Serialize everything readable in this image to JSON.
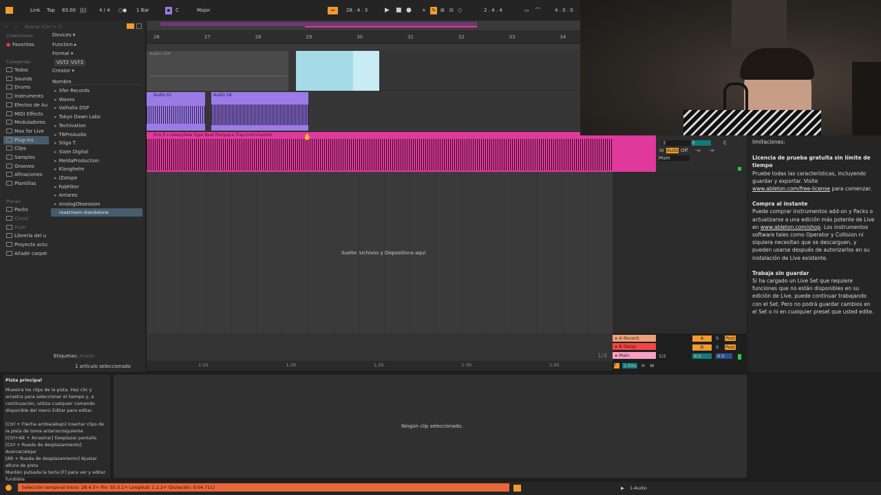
{
  "transport": {
    "link": "Link",
    "tap": "Tap",
    "tempo": "83.00",
    "meter_bars": "||||",
    "time_signature": "4 / 4",
    "metronome": "○●",
    "quantize": "1 Bar",
    "key_root": "C",
    "scale": "Major",
    "position": "28 .  4 .  3",
    "loop_start": "2 .  4 .  4",
    "loop_length": "4 .  0 .  0"
  },
  "browser": {
    "search_placeholder": "Buscar (Ctrl + F)",
    "collections_header": "Colecciones",
    "favorites": "Favoritos",
    "categories_header": "Categorías",
    "categories": [
      "Todos",
      "Sounds",
      "Drums",
      "Instruments",
      "Efectos de Au",
      "MIDI Effects",
      "Moduladores",
      "Max for Live",
      "Plug-ins",
      "Clips",
      "Samples",
      "Grooves",
      "Afinaciones",
      "Plantillas"
    ],
    "places_header": "Places",
    "places": [
      "Packs",
      "Cloud",
      "Push",
      "Librería del u",
      "Proyecto actu",
      "Añadir carpet"
    ],
    "filters": [
      "Devices ▾",
      "Function ▸",
      "Format ▾",
      "Creator ▾"
    ],
    "vst2": "VST2",
    "vst3": "VST3",
    "name_header": "Nombre",
    "items": [
      "Xfer Records",
      "Waves",
      "Valhalla DSP",
      "Tokyo Dawn Labs",
      "Techivation",
      "TBProAudio",
      "Stiga T.",
      "Slate Digital",
      "MeldaProduction",
      "Klanghelm",
      "iZotope",
      "FabFilter",
      "Antares",
      "AnalogObsession"
    ],
    "selected_item": "reastream-standalone",
    "tags_label": "Etiquetas:",
    "tags_value": "Añadir",
    "selection_count": "1 artículo seleccionado"
  },
  "ruler": {
    "bars": [
      "26",
      "27",
      "28",
      "29",
      "30",
      "31",
      "32",
      "33",
      "34"
    ]
  },
  "timeline": {
    "times": [
      "1:15",
      "1:20",
      "1:25",
      "1:30",
      "1:35"
    ],
    "grid": "1/4"
  },
  "tracks": {
    "track1_clip": "Audio 104",
    "track2_clip_a": "Audio 61",
    "track2_clip_b": "Audio 58",
    "track3_clip": "Kris R x GeezyDew Type Beat  Pampaca  Trap Instrumental",
    "drop_text": "Suelte Archivos y Dispositivos aquí"
  },
  "mixer": {
    "input_value": "2",
    "in": "In",
    "auto": "Auto",
    "off": "Off",
    "out_main": "Main",
    "vol_0": "0",
    "pan_c": "C",
    "minus_inf_1": "-∞",
    "minus_inf_2": "-∞"
  },
  "returns": {
    "reverb": "A Reverb",
    "delay": "B Delay",
    "main": "Main",
    "a": "A",
    "b": "B",
    "s": "S",
    "post": "Post",
    "half": "1/2",
    "minus_6_a": "-6.0",
    "minus_6_b": "-6.0",
    "speed": "1.00x",
    "h": "H",
    "w": "W"
  },
  "info_panel": {
    "p0": "limitaciones:",
    "h1": "Licencia de prueba gratuita sin límite de tiempo",
    "p1a": "Pruebe todas las características, incluyendo guardar y exportar. Visite ",
    "p1link": "www.ableton.com/free-license",
    "p1b": " para comenzar.",
    "h2": "Compra al instante",
    "p2a": "Puede comprar instrumentos add-on y Packs o actualizarse a una edición más potente de Live en ",
    "p2link": "www.ableton.com/shop",
    "p2b": ". Los instrumentos software tales como Operator y Collision ni siquiera necesitan que se descarguen, y pueden usarse después de autorizarlos en su instalación de Live existente.",
    "h3": "Trabaja sin guardar",
    "p3": "Si ha cargado un Live Set que requiere funciones que no están disponibles en su edición de Live, puede continuar trabajando con el Set. Pero no podrá guardar cambios en el Set o ni en cualquier preset que usted edite."
  },
  "help": {
    "title": "Pista principal",
    "body": "Muestra los clips de la pista. Haz clic y arrastra para seleccionar el tiempo y, a continuación, utiliza cualquier comando disponible del menú Editar para editar.",
    "shortcuts": "[Ctrl + Flecha arriba/abajo] Insertar clips de la pista de toma anterior/siguiente\n[Ctrl+Alt + Arrastrar] Desplazar pantalla\n[Ctrl + Rueda de desplazamiento] Acercar/alejar\n[Alt + Rueda de desplazamiento] Ajustar altura de pista\nMantén pulsada la tecla [F] para ver y editar fundidos"
  },
  "detail": {
    "no_clip": "Ningún clip seleccionado."
  },
  "status": {
    "selection": "Selección temporal   Inicio: 28.4.3+   Fin: 30.3.1+   Longitud: 1.2.2+  (Duración: 0:04.711)",
    "track_name": "1-Audio"
  },
  "colors": {
    "accent_orange": "#f29a2e",
    "clip_pink": "#e0399b",
    "clip_purple": "#9c7be6",
    "clip_light_blue": "#a6dbe8",
    "status_orange": "#e8663a"
  }
}
